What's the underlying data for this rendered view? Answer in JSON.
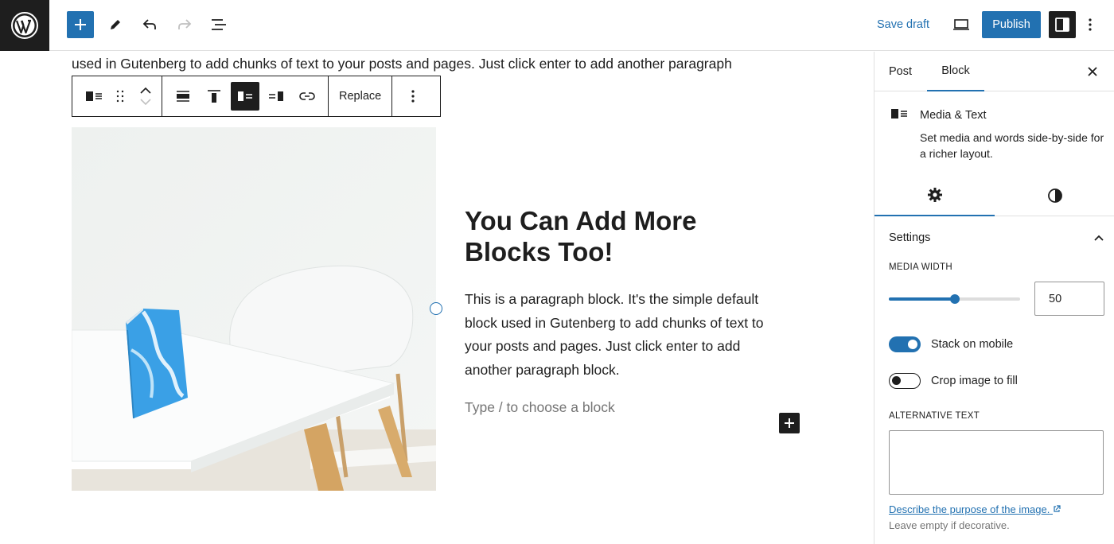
{
  "topbar": {
    "save_draft": "Save draft",
    "publish": "Publish"
  },
  "content": {
    "prev_paragraph": "used in Gutenberg to add chunks of text to your posts and pages. Just click enter to add another paragraph",
    "heading": "You Can Add More Blocks Too!",
    "paragraph": "This is a paragraph block. It's the simple default block used in Gutenberg to add chunks of text to your posts and pages. Just click enter to add another paragraph block.",
    "placeholder": "Type / to choose a block"
  },
  "block_toolbar": {
    "replace": "Replace"
  },
  "sidebar": {
    "tabs": [
      "Post",
      "Block"
    ],
    "active_tab": "Block",
    "block_title": "Media & Text",
    "block_description": "Set media and words side-by-side for a richer layout.",
    "panel_title": "Settings",
    "media_width_label": "MEDIA WIDTH",
    "media_width_value": "50",
    "media_width_level": 50,
    "stack_on_mobile": "Stack on mobile",
    "stack_on_mobile_on": true,
    "crop_image": "Crop image to fill",
    "crop_image_on": false,
    "alt_text_label": "ALTERNATIVE TEXT",
    "alt_text_value": "",
    "help_link": "Describe the purpose of the image.",
    "help_note": "Leave empty if decorative."
  },
  "colors": {
    "accent": "#2271b1",
    "dark": "#1e1e1e",
    "muted": "#757575"
  }
}
